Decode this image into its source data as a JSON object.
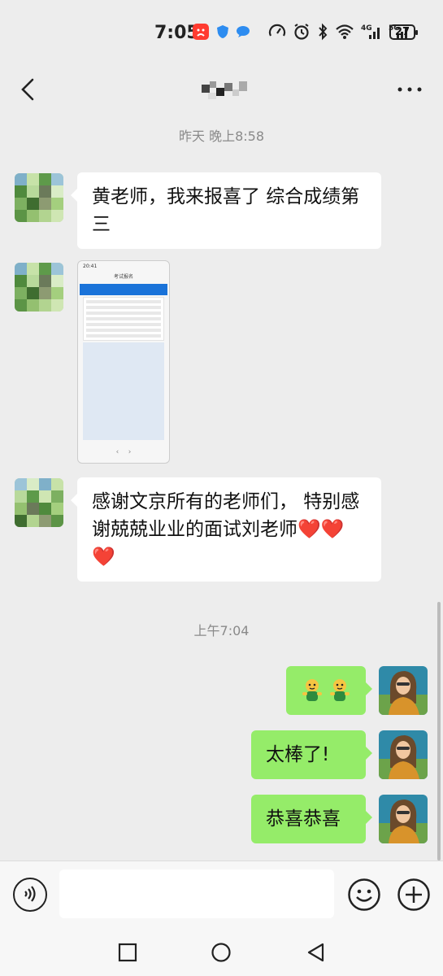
{
  "status_bar": {
    "time": "7:05",
    "battery": "27",
    "icons": [
      "alert-icon",
      "shield-icon",
      "chat-bubble-icon",
      "data-saver-icon",
      "alarm-icon",
      "bluetooth-icon",
      "wifi-icon",
      "signal-4g-icon",
      "signal-5g-icon"
    ]
  },
  "header": {
    "back_icon": "chevron-left-icon",
    "more_icon": "more-dots-icon"
  },
  "messages": [
    {
      "type": "timestamp",
      "text": "昨天 晚上8:58"
    },
    {
      "type": "text",
      "side": "left",
      "text": "黄老师，我来报喜了 综合成绩第三"
    },
    {
      "type": "image",
      "side": "left",
      "mini_time": "20:41",
      "mini_title": "考试报名"
    },
    {
      "type": "text",
      "side": "left",
      "text": "感谢文京所有的老师们， 特别感谢兢兢业业的面试刘老师❤️❤️❤️"
    },
    {
      "type": "timestamp",
      "text": "上午7:04"
    },
    {
      "type": "emoji",
      "side": "right",
      "emoji_names": [
        "dog-emoji",
        "dog-emoji"
      ]
    },
    {
      "type": "text",
      "side": "right",
      "text": "太棒了!"
    },
    {
      "type": "text",
      "side": "right",
      "text": "恭喜恭喜"
    }
  ],
  "input_bar": {
    "value": "",
    "voice_icon": "voice-icon",
    "emoji_icon": "emoji-icon",
    "plus_icon": "plus-icon"
  },
  "nav_bar": {
    "icons": [
      "recent-apps-icon",
      "home-icon",
      "back-triangle-icon"
    ]
  },
  "colors": {
    "background": "#ededed",
    "incoming_bubble": "#ffffff",
    "outgoing_bubble": "#95ec69"
  }
}
